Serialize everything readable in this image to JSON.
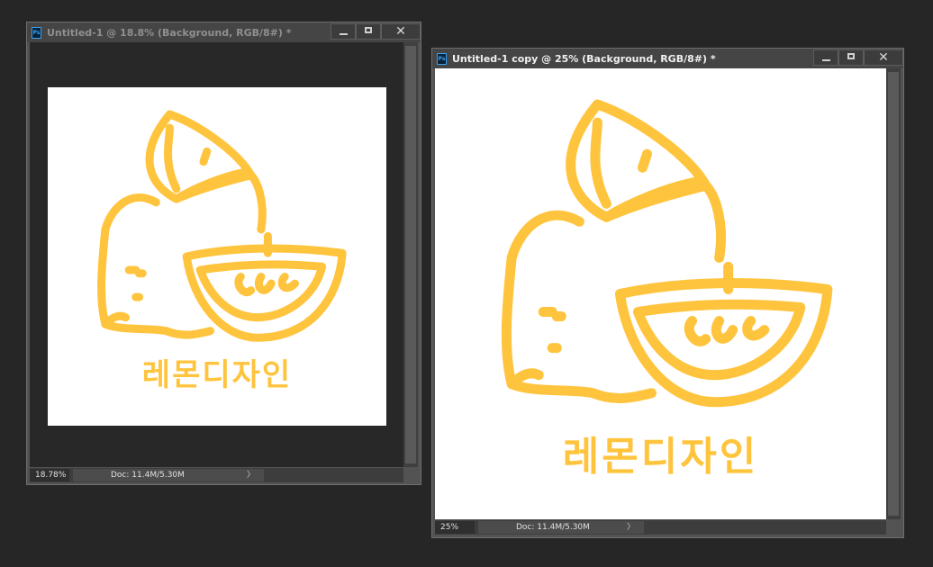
{
  "windows": [
    {
      "title": "Untitled-1 @ 18.8% (Background, RGB/8#) *",
      "title_color": "#8f8f8f",
      "zoom": "18.78%",
      "doc_info": "Doc: 11.4M/5.30M",
      "close_symbol": "✕"
    },
    {
      "title": "Untitled-1 copy @ 25% (Background, RGB/8#) *",
      "title_color": "#f0f0f0",
      "zoom": "25%",
      "doc_info": "Doc: 11.4M/5.30M",
      "close_symbol": "✕"
    }
  ],
  "artwork": {
    "caption": "레몬디자인",
    "stroke_color": "#ffc43d"
  },
  "colors": {
    "workspace": "#262626",
    "ps_icon_blue": "#38a3f5"
  }
}
